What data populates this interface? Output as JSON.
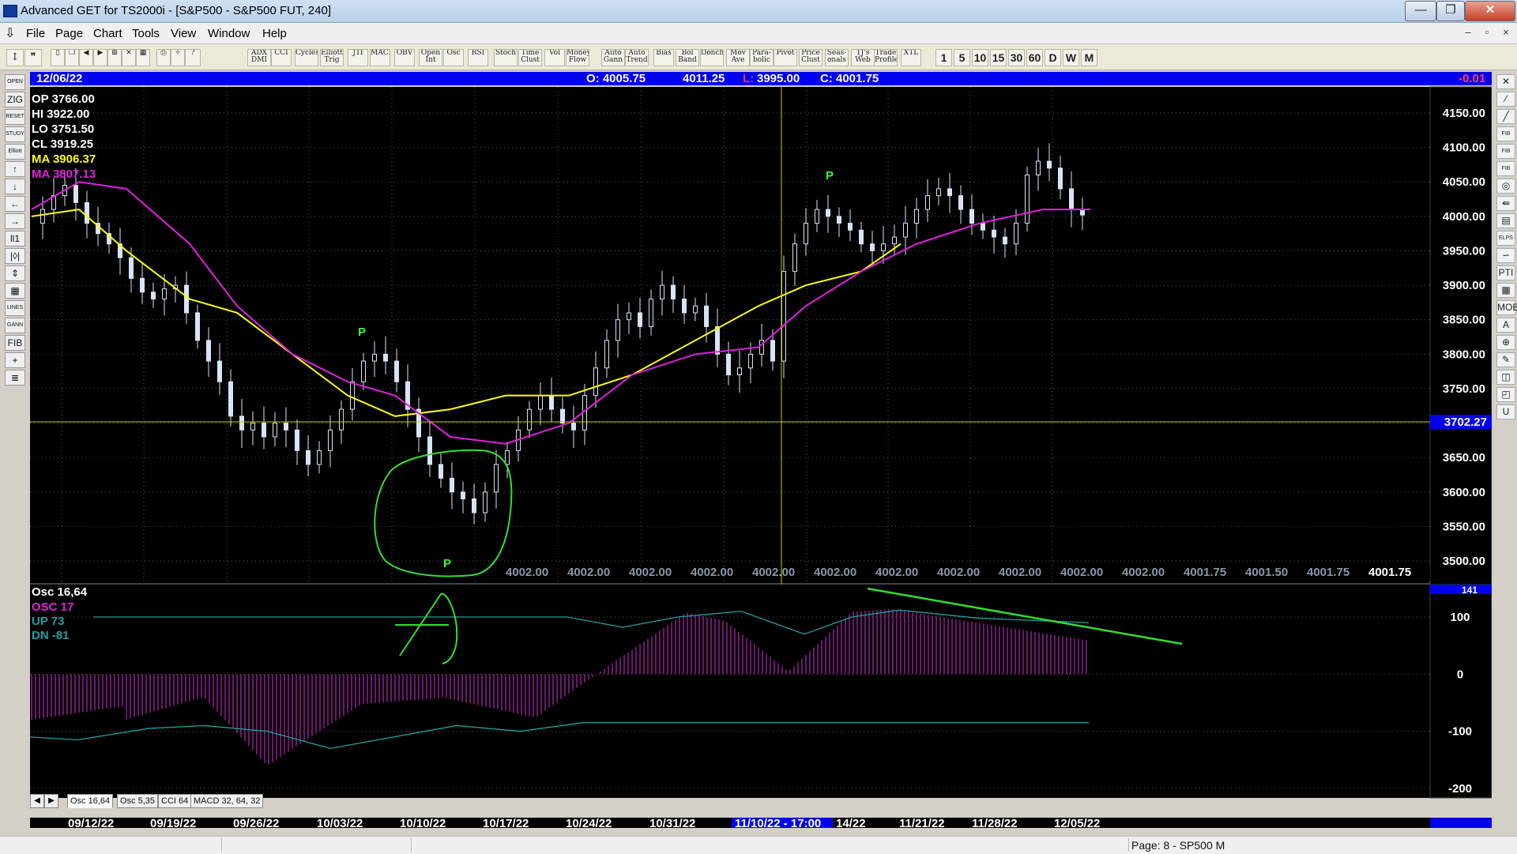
{
  "window": {
    "title": "Advanced GET for TS2000i - [S&P500 - S&P500 FUT, 240]",
    "buttons": [
      "—",
      "❐",
      "✕"
    ]
  },
  "menu": {
    "items": [
      "File",
      "Page",
      "Chart",
      "Tools",
      "View",
      "Window",
      "Help"
    ],
    "mdi_buttons": [
      "–",
      "▫",
      "×"
    ]
  },
  "toolbar": {
    "study_buttons": [
      "ADX DMI",
      "CCI",
      "Cycles",
      "Elliott Trig",
      "JTI",
      "MACD",
      "OBV",
      "Open Int",
      "Osc",
      "RSI",
      "Stoch",
      "Time Clust",
      "Vol",
      "Money Flow",
      "Auto Gann",
      "Auto Trend",
      "Bias",
      "Bol Band",
      "Donch",
      "Mov Ave",
      "Para- bolic",
      "Pivot",
      "Price Clust",
      "Seas- onals",
      "TJ's Web",
      "Trade Profile",
      "XTL"
    ],
    "period_buttons": [
      "1",
      "5",
      "10",
      "15",
      "30",
      "60",
      "D",
      "W",
      "M"
    ]
  },
  "left_tools": [
    "OPEN",
    "ZIG",
    "RESET",
    "STUDY",
    "Elliott",
    "↑",
    "↓",
    "←",
    "→",
    "ll1",
    "|◊|",
    "⇕",
    "▦",
    "LINES",
    "GANN",
    "FIB",
    "+",
    "≣"
  ],
  "right_tools": [
    "✕",
    "⁄",
    "╱",
    "FIB RET",
    "FIB EXT",
    "FIB TIME",
    "◎",
    "⇚",
    "▤",
    "ELPS",
    "∽",
    "PTI",
    "▦",
    "MOB",
    "A",
    "⊕",
    "✎",
    "◫",
    "◰",
    "U"
  ],
  "info_bar": {
    "date": "12/06/22",
    "open": "O: 4005.75",
    "high": "4011.25",
    "low_label": "L:",
    "low_value": "3995.00",
    "close": "C: 4001.75",
    "change": "-0.01"
  },
  "price_panel": {
    "ohlc_labels": [
      {
        "text": "OP  3766.00",
        "color": "#ffffff"
      },
      {
        "text": "HI   3922.00",
        "color": "#ffffff"
      },
      {
        "text": "LO  3751.50",
        "color": "#ffffff"
      },
      {
        "text": "CL  3919.25",
        "color": "#ffffff"
      },
      {
        "text": "MA  3906.37",
        "color": "#ffff00"
      },
      {
        "text": "MA  3807.13",
        "color": "#e020e0"
      }
    ],
    "y_ticks": [
      "4150.00",
      "4100.00",
      "4050.00",
      "4000.00",
      "3950.00",
      "3900.00",
      "3850.00",
      "3800.00",
      "3750.00",
      "3700.00",
      "3650.00",
      "3600.00",
      "3550.00",
      "3500.00"
    ],
    "crosshair_price": "3702.27",
    "bottom_values": [
      "4002.00",
      "4002.00",
      "4002.00",
      "4002.00",
      "4002.00",
      "4002.00",
      "4002.00",
      "4002.00",
      "4002.00",
      "4002.00",
      "4002.00",
      "4001.75",
      "4001.50",
      "4001.75"
    ],
    "last_price": "4001.75",
    "pivot_marker": "P"
  },
  "osc_panel": {
    "title": "Osc 16,64",
    "labels": [
      {
        "text": "OSC 17",
        "color": "#e020e0"
      },
      {
        "text": "UP  73",
        "color": "#20a0a0"
      },
      {
        "text": "DN  -81",
        "color": "#20a0a0"
      }
    ],
    "y_ticks": [
      "100",
      "0",
      "-100",
      "-200"
    ],
    "top_value": "141"
  },
  "tabs": [
    "Osc 16,64",
    "Osc 5,35",
    "CCI 64",
    "MACD 32, 64, 32"
  ],
  "date_axis": [
    "09/12/22",
    "09/19/22",
    "09/26/22",
    "10/03/22",
    "10/10/22",
    "10/17/22",
    "10/24/22",
    "10/31/22",
    "14/22",
    "11/21/22",
    "11/28/22",
    "12/05/22"
  ],
  "crosshair_date": "11/10/22 - 17:00",
  "status": {
    "text": "Page: 8 - SP500 M"
  },
  "colors": {
    "background": "#000000",
    "candle": "#d8e4f8",
    "ma_fast": "#ffff00",
    "ma_slow": "#e020e0",
    "osc_hist": "#a020a0",
    "osc_band": "#20a0a0",
    "annotation": "#33dd33",
    "crosshair": "#c8c800",
    "info_bar": "#0000ee"
  }
}
